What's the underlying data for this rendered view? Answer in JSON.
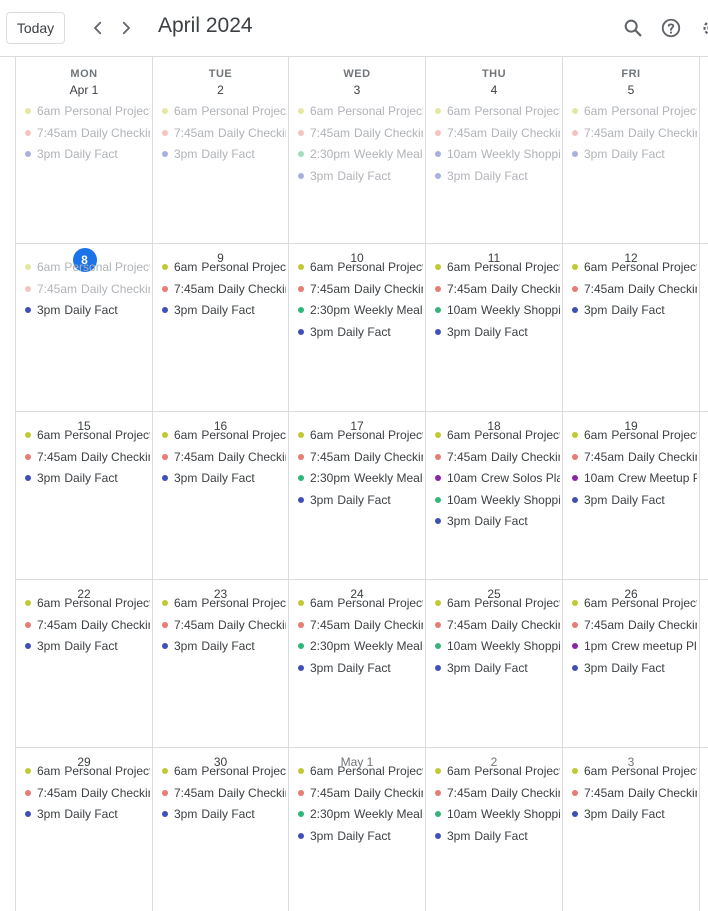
{
  "header": {
    "today_label": "Today",
    "month_title": "April 2024",
    "prev_icon": "chevron-left-icon",
    "next_icon": "chevron-right-icon",
    "search_icon": "search-icon",
    "help_icon": "help-icon",
    "settings_icon": "gear-icon"
  },
  "colors": {
    "olive": "#c0ca33",
    "coral": "#e67c73",
    "navy": "#3f51b5",
    "teal": "#33b679",
    "purple": "#8e24aa",
    "today": "#1a73e8"
  },
  "weekdays": [
    "MON",
    "TUE",
    "WED",
    "THU",
    "FRI"
  ],
  "weeks": [
    [
      {
        "label": "Apr 1",
        "past": true,
        "events": [
          {
            "time": "6am",
            "title": "Personal Projects",
            "color": "#c0ca33",
            "past": true
          },
          {
            "time": "7:45am",
            "title": "Daily Checkin",
            "color": "#e67c73",
            "past": true
          },
          {
            "time": "3pm",
            "title": "Daily Fact",
            "color": "#3f51b5",
            "past": true
          }
        ]
      },
      {
        "label": "2",
        "past": true,
        "events": [
          {
            "time": "6am",
            "title": "Personal Projects",
            "color": "#c0ca33",
            "past": true
          },
          {
            "time": "7:45am",
            "title": "Daily Checkin",
            "color": "#e67c73",
            "past": true
          },
          {
            "time": "3pm",
            "title": "Daily Fact",
            "color": "#3f51b5",
            "past": true
          }
        ]
      },
      {
        "label": "3",
        "past": true,
        "events": [
          {
            "time": "6am",
            "title": "Personal Projects",
            "color": "#c0ca33",
            "past": true
          },
          {
            "time": "7:45am",
            "title": "Daily Checkin",
            "color": "#e67c73",
            "past": true
          },
          {
            "time": "2:30pm",
            "title": "Weekly Meal Pl",
            "color": "#33b679",
            "past": true
          },
          {
            "time": "3pm",
            "title": "Daily Fact",
            "color": "#3f51b5",
            "past": true
          }
        ]
      },
      {
        "label": "4",
        "past": true,
        "events": [
          {
            "time": "6am",
            "title": "Personal Projects",
            "color": "#c0ca33",
            "past": true
          },
          {
            "time": "7:45am",
            "title": "Daily Checkin",
            "color": "#e67c73",
            "past": true
          },
          {
            "time": "10am",
            "title": "Weekly Shopping",
            "color": "#3f51b5",
            "past": true
          },
          {
            "time": "3pm",
            "title": "Daily Fact",
            "color": "#3f51b5",
            "past": true
          }
        ]
      },
      {
        "label": "5",
        "past": true,
        "events": [
          {
            "time": "6am",
            "title": "Personal Projects",
            "color": "#c0ca33",
            "past": true
          },
          {
            "time": "7:45am",
            "title": "Daily Checkin",
            "color": "#e67c73",
            "past": true
          },
          {
            "time": "3pm",
            "title": "Daily Fact",
            "color": "#3f51b5",
            "past": true
          }
        ]
      }
    ],
    [
      {
        "label": "8",
        "today": true,
        "events": [
          {
            "time": "6am",
            "title": "Personal Projects",
            "color": "#c0ca33",
            "past": true
          },
          {
            "time": "7:45am",
            "title": "Daily Checkin",
            "color": "#e67c73",
            "past": true
          },
          {
            "time": "3pm",
            "title": "Daily Fact",
            "color": "#3f51b5"
          }
        ]
      },
      {
        "label": "9",
        "events": [
          {
            "time": "6am",
            "title": "Personal Projects",
            "color": "#c0ca33"
          },
          {
            "time": "7:45am",
            "title": "Daily Checkin",
            "color": "#e67c73"
          },
          {
            "time": "3pm",
            "title": "Daily Fact",
            "color": "#3f51b5"
          }
        ]
      },
      {
        "label": "10",
        "events": [
          {
            "time": "6am",
            "title": "Personal Projects",
            "color": "#c0ca33"
          },
          {
            "time": "7:45am",
            "title": "Daily Checkin",
            "color": "#e67c73"
          },
          {
            "time": "2:30pm",
            "title": "Weekly Meal Pl",
            "color": "#33b679"
          },
          {
            "time": "3pm",
            "title": "Daily Fact",
            "color": "#3f51b5"
          }
        ]
      },
      {
        "label": "11",
        "events": [
          {
            "time": "6am",
            "title": "Personal Projects",
            "color": "#c0ca33"
          },
          {
            "time": "7:45am",
            "title": "Daily Checkin",
            "color": "#e67c73"
          },
          {
            "time": "10am",
            "title": "Weekly Shopping",
            "color": "#33b679"
          },
          {
            "time": "3pm",
            "title": "Daily Fact",
            "color": "#3f51b5"
          }
        ]
      },
      {
        "label": "12",
        "events": [
          {
            "time": "6am",
            "title": "Personal Projects",
            "color": "#c0ca33"
          },
          {
            "time": "7:45am",
            "title": "Daily Checkin",
            "color": "#e67c73"
          },
          {
            "time": "3pm",
            "title": "Daily Fact",
            "color": "#3f51b5"
          }
        ]
      }
    ],
    [
      {
        "label": "15",
        "events": [
          {
            "time": "6am",
            "title": "Personal Projects",
            "color": "#c0ca33"
          },
          {
            "time": "7:45am",
            "title": "Daily Checkin",
            "color": "#e67c73"
          },
          {
            "time": "3pm",
            "title": "Daily Fact",
            "color": "#3f51b5"
          }
        ]
      },
      {
        "label": "16",
        "events": [
          {
            "time": "6am",
            "title": "Personal Projects",
            "color": "#c0ca33"
          },
          {
            "time": "7:45am",
            "title": "Daily Checkin",
            "color": "#e67c73"
          },
          {
            "time": "3pm",
            "title": "Daily Fact",
            "color": "#3f51b5"
          }
        ]
      },
      {
        "label": "17",
        "events": [
          {
            "time": "6am",
            "title": "Personal Projects",
            "color": "#c0ca33"
          },
          {
            "time": "7:45am",
            "title": "Daily Checkin",
            "color": "#e67c73"
          },
          {
            "time": "2:30pm",
            "title": "Weekly Meal Pl",
            "color": "#33b679"
          },
          {
            "time": "3pm",
            "title": "Daily Fact",
            "color": "#3f51b5"
          }
        ]
      },
      {
        "label": "18",
        "events": [
          {
            "time": "6am",
            "title": "Personal Projects",
            "color": "#c0ca33"
          },
          {
            "time": "7:45am",
            "title": "Daily Checkin",
            "color": "#e67c73"
          },
          {
            "time": "10am",
            "title": "Crew Solos Plan",
            "color": "#8e24aa"
          },
          {
            "time": "10am",
            "title": "Weekly Shopping",
            "color": "#33b679"
          },
          {
            "time": "3pm",
            "title": "Daily Fact",
            "color": "#3f51b5"
          }
        ]
      },
      {
        "label": "19",
        "events": [
          {
            "time": "6am",
            "title": "Personal Projects",
            "color": "#c0ca33"
          },
          {
            "time": "7:45am",
            "title": "Daily Checkin",
            "color": "#e67c73"
          },
          {
            "time": "10am",
            "title": "Crew Meetup P",
            "color": "#8e24aa"
          },
          {
            "time": "3pm",
            "title": "Daily Fact",
            "color": "#3f51b5"
          }
        ]
      }
    ],
    [
      {
        "label": "22",
        "events": [
          {
            "time": "6am",
            "title": "Personal Projects",
            "color": "#c0ca33"
          },
          {
            "time": "7:45am",
            "title": "Daily Checkin",
            "color": "#e67c73"
          },
          {
            "time": "3pm",
            "title": "Daily Fact",
            "color": "#3f51b5"
          }
        ]
      },
      {
        "label": "23",
        "events": [
          {
            "time": "6am",
            "title": "Personal Projects",
            "color": "#c0ca33"
          },
          {
            "time": "7:45am",
            "title": "Daily Checkin",
            "color": "#e67c73"
          },
          {
            "time": "3pm",
            "title": "Daily Fact",
            "color": "#3f51b5"
          }
        ]
      },
      {
        "label": "24",
        "events": [
          {
            "time": "6am",
            "title": "Personal Projects",
            "color": "#c0ca33"
          },
          {
            "time": "7:45am",
            "title": "Daily Checkin",
            "color": "#e67c73"
          },
          {
            "time": "2:30pm",
            "title": "Weekly Meal Pl",
            "color": "#33b679"
          },
          {
            "time": "3pm",
            "title": "Daily Fact",
            "color": "#3f51b5"
          }
        ]
      },
      {
        "label": "25",
        "events": [
          {
            "time": "6am",
            "title": "Personal Projects",
            "color": "#c0ca33"
          },
          {
            "time": "7:45am",
            "title": "Daily Checkin",
            "color": "#e67c73"
          },
          {
            "time": "10am",
            "title": "Weekly Shopping",
            "color": "#33b679"
          },
          {
            "time": "3pm",
            "title": "Daily Fact",
            "color": "#3f51b5"
          }
        ]
      },
      {
        "label": "26",
        "events": [
          {
            "time": "6am",
            "title": "Personal Projects",
            "color": "#c0ca33"
          },
          {
            "time": "7:45am",
            "title": "Daily Checkin",
            "color": "#e67c73"
          },
          {
            "time": "1pm",
            "title": "Crew meetup Pla",
            "color": "#8e24aa"
          },
          {
            "time": "3pm",
            "title": "Daily Fact",
            "color": "#3f51b5"
          }
        ]
      }
    ],
    [
      {
        "label": "29",
        "events": [
          {
            "time": "6am",
            "title": "Personal Projects",
            "color": "#c0ca33"
          },
          {
            "time": "7:45am",
            "title": "Daily Checkin",
            "color": "#e67c73"
          },
          {
            "time": "3pm",
            "title": "Daily Fact",
            "color": "#3f51b5"
          }
        ]
      },
      {
        "label": "30",
        "events": [
          {
            "time": "6am",
            "title": "Personal Projects",
            "color": "#c0ca33"
          },
          {
            "time": "7:45am",
            "title": "Daily Checkin",
            "color": "#e67c73"
          },
          {
            "time": "3pm",
            "title": "Daily Fact",
            "color": "#3f51b5"
          }
        ]
      },
      {
        "label": "May 1",
        "muted": true,
        "events": [
          {
            "time": "6am",
            "title": "Personal Projects",
            "color": "#c0ca33"
          },
          {
            "time": "7:45am",
            "title": "Daily Checkin",
            "color": "#e67c73"
          },
          {
            "time": "2:30pm",
            "title": "Weekly Meal Pl",
            "color": "#33b679"
          },
          {
            "time": "3pm",
            "title": "Daily Fact",
            "color": "#3f51b5"
          }
        ]
      },
      {
        "label": "2",
        "muted": true,
        "events": [
          {
            "time": "6am",
            "title": "Personal Projects",
            "color": "#c0ca33"
          },
          {
            "time": "7:45am",
            "title": "Daily Checkin",
            "color": "#e67c73"
          },
          {
            "time": "10am",
            "title": "Weekly Shopping",
            "color": "#33b679"
          },
          {
            "time": "3pm",
            "title": "Daily Fact",
            "color": "#3f51b5"
          }
        ]
      },
      {
        "label": "3",
        "muted": true,
        "events": [
          {
            "time": "6am",
            "title": "Personal Projects",
            "color": "#c0ca33"
          },
          {
            "time": "7:45am",
            "title": "Daily Checkin",
            "color": "#e67c73"
          },
          {
            "time": "3pm",
            "title": "Daily Fact",
            "color": "#3f51b5"
          }
        ]
      }
    ]
  ]
}
